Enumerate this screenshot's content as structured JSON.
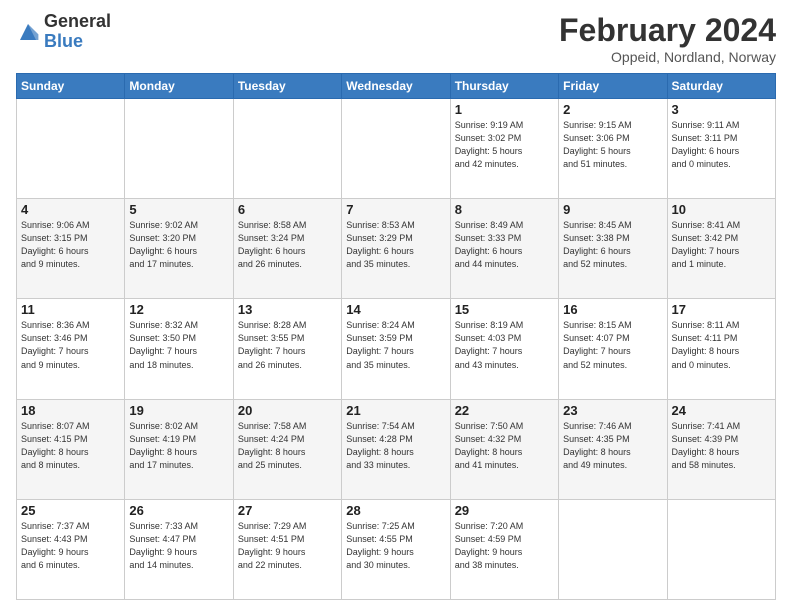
{
  "logo": {
    "general": "General",
    "blue": "Blue"
  },
  "header": {
    "title": "February 2024",
    "location": "Oppeid, Nordland, Norway"
  },
  "weekdays": [
    "Sunday",
    "Monday",
    "Tuesday",
    "Wednesday",
    "Thursday",
    "Friday",
    "Saturday"
  ],
  "weeks": [
    [
      {
        "day": "",
        "info": ""
      },
      {
        "day": "",
        "info": ""
      },
      {
        "day": "",
        "info": ""
      },
      {
        "day": "",
        "info": ""
      },
      {
        "day": "1",
        "info": "Sunrise: 9:19 AM\nSunset: 3:02 PM\nDaylight: 5 hours\nand 42 minutes."
      },
      {
        "day": "2",
        "info": "Sunrise: 9:15 AM\nSunset: 3:06 PM\nDaylight: 5 hours\nand 51 minutes."
      },
      {
        "day": "3",
        "info": "Sunrise: 9:11 AM\nSunset: 3:11 PM\nDaylight: 6 hours\nand 0 minutes."
      }
    ],
    [
      {
        "day": "4",
        "info": "Sunrise: 9:06 AM\nSunset: 3:15 PM\nDaylight: 6 hours\nand 9 minutes."
      },
      {
        "day": "5",
        "info": "Sunrise: 9:02 AM\nSunset: 3:20 PM\nDaylight: 6 hours\nand 17 minutes."
      },
      {
        "day": "6",
        "info": "Sunrise: 8:58 AM\nSunset: 3:24 PM\nDaylight: 6 hours\nand 26 minutes."
      },
      {
        "day": "7",
        "info": "Sunrise: 8:53 AM\nSunset: 3:29 PM\nDaylight: 6 hours\nand 35 minutes."
      },
      {
        "day": "8",
        "info": "Sunrise: 8:49 AM\nSunset: 3:33 PM\nDaylight: 6 hours\nand 44 minutes."
      },
      {
        "day": "9",
        "info": "Sunrise: 8:45 AM\nSunset: 3:38 PM\nDaylight: 6 hours\nand 52 minutes."
      },
      {
        "day": "10",
        "info": "Sunrise: 8:41 AM\nSunset: 3:42 PM\nDaylight: 7 hours\nand 1 minute."
      }
    ],
    [
      {
        "day": "11",
        "info": "Sunrise: 8:36 AM\nSunset: 3:46 PM\nDaylight: 7 hours\nand 9 minutes."
      },
      {
        "day": "12",
        "info": "Sunrise: 8:32 AM\nSunset: 3:50 PM\nDaylight: 7 hours\nand 18 minutes."
      },
      {
        "day": "13",
        "info": "Sunrise: 8:28 AM\nSunset: 3:55 PM\nDaylight: 7 hours\nand 26 minutes."
      },
      {
        "day": "14",
        "info": "Sunrise: 8:24 AM\nSunset: 3:59 PM\nDaylight: 7 hours\nand 35 minutes."
      },
      {
        "day": "15",
        "info": "Sunrise: 8:19 AM\nSunset: 4:03 PM\nDaylight: 7 hours\nand 43 minutes."
      },
      {
        "day": "16",
        "info": "Sunrise: 8:15 AM\nSunset: 4:07 PM\nDaylight: 7 hours\nand 52 minutes."
      },
      {
        "day": "17",
        "info": "Sunrise: 8:11 AM\nSunset: 4:11 PM\nDaylight: 8 hours\nand 0 minutes."
      }
    ],
    [
      {
        "day": "18",
        "info": "Sunrise: 8:07 AM\nSunset: 4:15 PM\nDaylight: 8 hours\nand 8 minutes."
      },
      {
        "day": "19",
        "info": "Sunrise: 8:02 AM\nSunset: 4:19 PM\nDaylight: 8 hours\nand 17 minutes."
      },
      {
        "day": "20",
        "info": "Sunrise: 7:58 AM\nSunset: 4:24 PM\nDaylight: 8 hours\nand 25 minutes."
      },
      {
        "day": "21",
        "info": "Sunrise: 7:54 AM\nSunset: 4:28 PM\nDaylight: 8 hours\nand 33 minutes."
      },
      {
        "day": "22",
        "info": "Sunrise: 7:50 AM\nSunset: 4:32 PM\nDaylight: 8 hours\nand 41 minutes."
      },
      {
        "day": "23",
        "info": "Sunrise: 7:46 AM\nSunset: 4:35 PM\nDaylight: 8 hours\nand 49 minutes."
      },
      {
        "day": "24",
        "info": "Sunrise: 7:41 AM\nSunset: 4:39 PM\nDaylight: 8 hours\nand 58 minutes."
      }
    ],
    [
      {
        "day": "25",
        "info": "Sunrise: 7:37 AM\nSunset: 4:43 PM\nDaylight: 9 hours\nand 6 minutes."
      },
      {
        "day": "26",
        "info": "Sunrise: 7:33 AM\nSunset: 4:47 PM\nDaylight: 9 hours\nand 14 minutes."
      },
      {
        "day": "27",
        "info": "Sunrise: 7:29 AM\nSunset: 4:51 PM\nDaylight: 9 hours\nand 22 minutes."
      },
      {
        "day": "28",
        "info": "Sunrise: 7:25 AM\nSunset: 4:55 PM\nDaylight: 9 hours\nand 30 minutes."
      },
      {
        "day": "29",
        "info": "Sunrise: 7:20 AM\nSunset: 4:59 PM\nDaylight: 9 hours\nand 38 minutes."
      },
      {
        "day": "",
        "info": ""
      },
      {
        "day": "",
        "info": ""
      }
    ]
  ]
}
